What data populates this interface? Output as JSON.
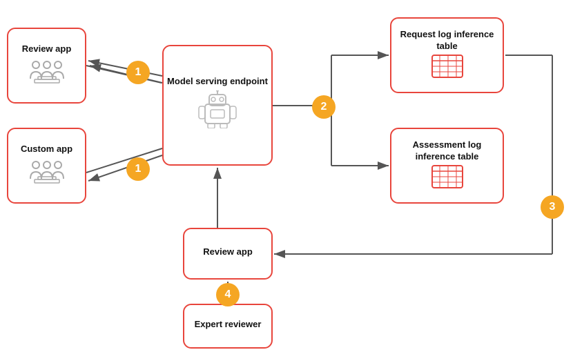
{
  "boxes": {
    "review_app_tl": {
      "label": "Review app",
      "icon": "users"
    },
    "custom_app": {
      "label": "Custom app",
      "icon": "users"
    },
    "model_serving": {
      "label": "Model serving endpoint",
      "icon": "robot"
    },
    "request_log": {
      "label": "Request log inference table",
      "icon": "table"
    },
    "assessment_log": {
      "label": "Assessment log inference table",
      "icon": "table"
    },
    "review_app_bc": {
      "label": "Review app",
      "icon": "none"
    },
    "expert_reviewer": {
      "label": "Expert reviewer",
      "icon": "none"
    }
  },
  "badges": {
    "b1a": "1",
    "b1b": "1",
    "b2": "2",
    "b3": "3",
    "b4": "4"
  },
  "colors": {
    "border": "#e8453c",
    "badge": "#f5a623",
    "arrow": "#555",
    "icon_gray": "#aaaaaa",
    "icon_red": "#e8453c"
  }
}
